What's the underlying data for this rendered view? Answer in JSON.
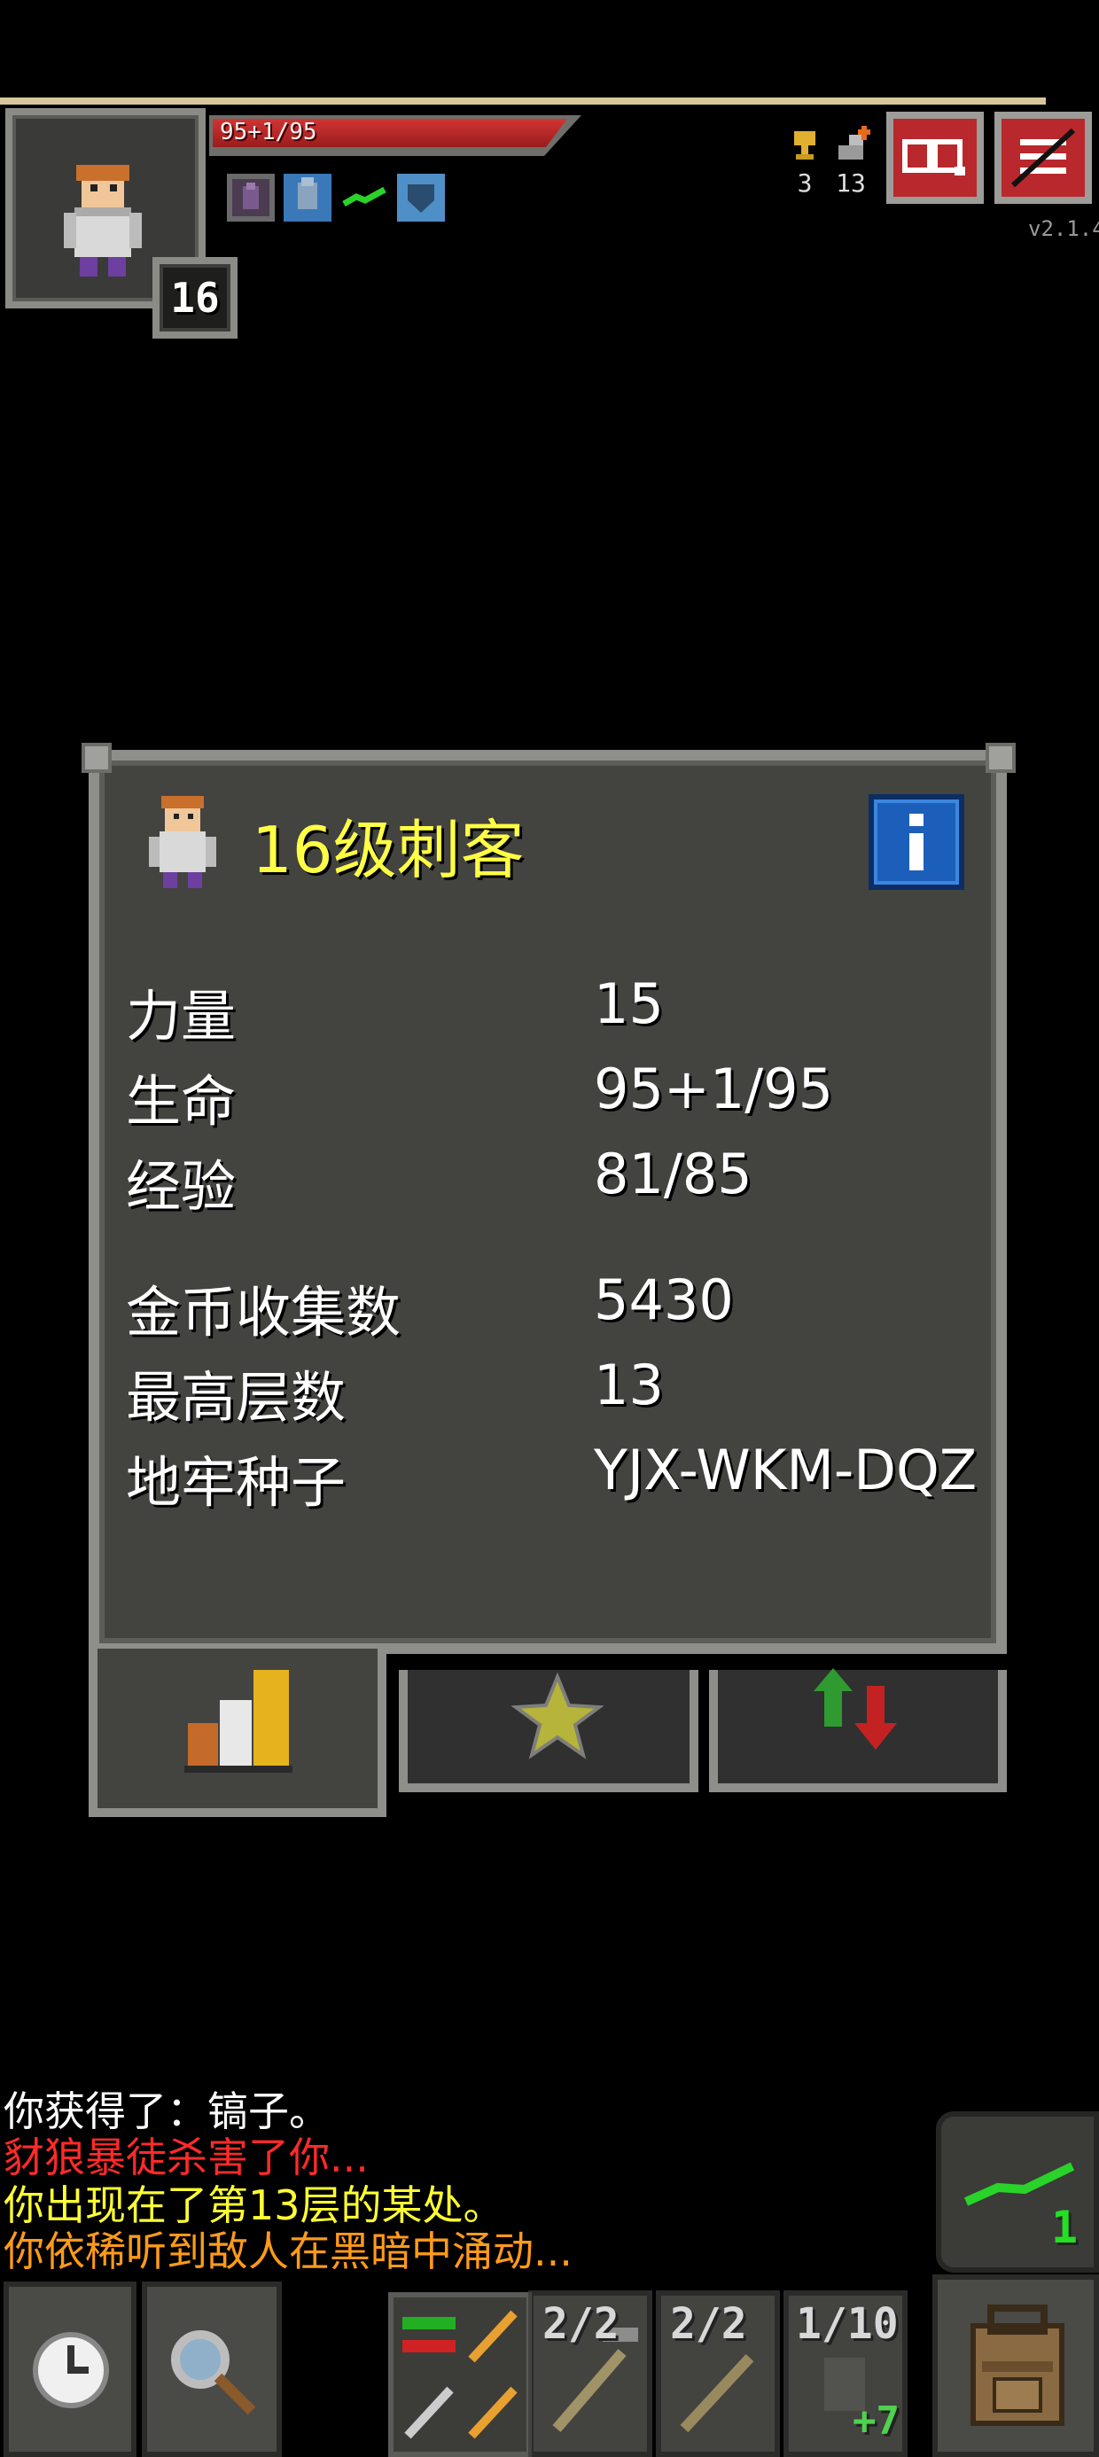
{
  "hud": {
    "hp_text": "95+1/95",
    "hp_fraction": 1.0,
    "level": "16",
    "trophies": "3",
    "depth": "13",
    "version": "v2.1.4",
    "buff_icons": [
      "shadow-buff-icon",
      "armor-buff-icon",
      "green-dash-buff-icon",
      "shield-buff-icon"
    ]
  },
  "window": {
    "title": "16级刺客",
    "stats": [
      {
        "label": "力量",
        "value": "15"
      },
      {
        "label": "生命",
        "value": "95+1/95"
      },
      {
        "label": "经验",
        "value": "81/85"
      }
    ],
    "stats2": [
      {
        "label": "金币收集数",
        "value": "5430"
      },
      {
        "label": "最高层数",
        "value": "13"
      },
      {
        "label": "地牢种子",
        "value": "YJX-WKM-DQZ"
      }
    ],
    "tabs": [
      "stats-tab",
      "badges-tab",
      "challenges-tab"
    ]
  },
  "log": [
    {
      "text": "你获得了：镐子。",
      "color": "#ffffff"
    },
    {
      "text": "豺狼暴徒杀害了你...",
      "color": "#ff2a2a"
    },
    {
      "text": "你出现在了第13层的某处。",
      "color": "#ffff33"
    },
    {
      "text": "你依稀听到敌人在黑暗中涌动...",
      "color": "#ff9a1a"
    }
  ],
  "toolbar": {
    "quiver_count": "1",
    "quickslots": [
      {
        "count": "2/2"
      },
      {
        "count": "2/2"
      },
      {
        "count": "1/10",
        "upgrade": "+7"
      }
    ]
  },
  "colors": {
    "title": "#ffff44",
    "window_bg": "#434340",
    "info_button": "#1c5fbb",
    "hp_bar": "#d23434"
  }
}
